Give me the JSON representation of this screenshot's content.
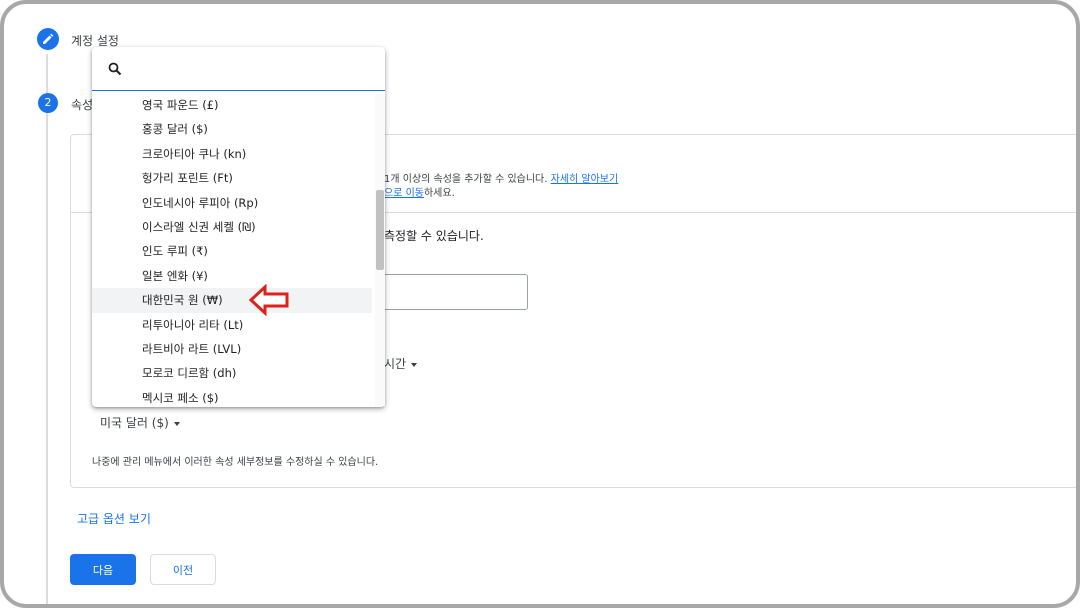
{
  "steps": {
    "step1": {
      "label": "계정 설정"
    },
    "step2": {
      "number": "2",
      "label": "속성"
    }
  },
  "card": {
    "info_text": "1개 이상의 속성을 추가할 수 있습니다.",
    "info_link": "자세히 알아보기",
    "move_link": "으로 이동",
    "move_suffix": "하세요.",
    "measure_text": "측정할 수 있습니다.",
    "timezone_text": "시간",
    "currency_value": "미국 달러 ($)",
    "footer_text": "나중에 관리 메뉴에서 이러한 속성 세부정보를 수정하실 수 있습니다."
  },
  "advanced_link": "고급 옵션 보기",
  "buttons": {
    "next": "다음",
    "previous": "이전"
  },
  "dropdown": {
    "search_placeholder": "",
    "items": [
      "영국 파운드 (£)",
      "홍콩 달러 ($)",
      "크로아티아 쿠나 (kn)",
      "헝가리 포린트 (Ft)",
      "인도네시아 루피아 (Rp)",
      "이스라엘 신권 세켈 (₪)",
      "인도 루피 (₹)",
      "일본 엔화 (¥)",
      "대한민국 원 (₩)",
      "리투아니아 리타 (Lt)",
      "라트비아 라트 (LVL)",
      "모로코 디르함 (dh)",
      "멕시코 페소 ($)"
    ],
    "selected_index": 8
  },
  "colors": {
    "accent": "#1a73e8",
    "arrow": "#e0201b"
  },
  "icons": {
    "step_done": "pencil-icon",
    "search": "search-icon",
    "annotation": "arrow-left-icon"
  }
}
